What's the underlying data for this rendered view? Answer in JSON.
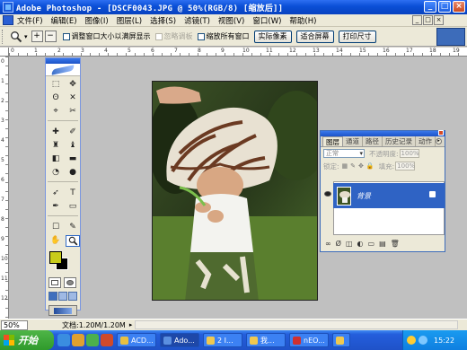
{
  "window": {
    "title": "Adobe Photoshop - [DSCF0043.JPG @ 50%(RGB/8) [缩放后]]",
    "controls": [
      "_",
      "□",
      "×"
    ]
  },
  "menu": {
    "items": [
      "文件(F)",
      "编辑(E)",
      "图像(I)",
      "图层(L)",
      "选择(S)",
      "滤镜(T)",
      "视图(V)",
      "窗口(W)",
      "帮助(H)"
    ],
    "mdi_controls": [
      "_",
      "□",
      "×"
    ]
  },
  "options": {
    "zoom_in": "+",
    "zoom_out": "−",
    "resize_windows": "调整窗口大小以满屏显示",
    "ignore_palettes": "忽略调板",
    "zoom_all_windows": "缩放所有窗口",
    "actual_pixels": "实际像素",
    "fit_on_screen": "适合屏幕",
    "print_size": "打印尺寸"
  },
  "rulers": {
    "top": [
      "0",
      "1",
      "2",
      "3",
      "4",
      "5",
      "6",
      "7",
      "8",
      "9",
      "10",
      "11",
      "12",
      "13",
      "14",
      "15",
      "16",
      "17",
      "18",
      "19"
    ],
    "left": [
      "0",
      "1",
      "2",
      "3",
      "4",
      "5",
      "6",
      "7",
      "8",
      "9",
      "10",
      "11",
      "12"
    ]
  },
  "toolbox": {
    "tools": [
      "⬚",
      "✥",
      "ʘ",
      "✕",
      "⌖",
      "✂",
      "✚",
      "✐",
      "♜",
      "♝",
      "◧",
      "▬",
      "◔",
      "●",
      "➶",
      "T",
      "✒",
      "▭",
      "☐",
      "✎",
      "✋",
      "🔍"
    ],
    "active_tool": "🔍",
    "fg_color": "#c8cc1a",
    "bg_color": "#000000"
  },
  "layers_panel": {
    "tabs": [
      "图层",
      "通道",
      "路径",
      "历史记录",
      "动作"
    ],
    "active_tab": "图层",
    "blend_mode": "正常",
    "opacity_label": "不透明度:",
    "opacity_value": "100%",
    "lock_label": "锁定:",
    "fill_label": "填充:",
    "fill_value": "100%",
    "layer_name": "背景",
    "bottom_icons": [
      "∞",
      "Ø",
      "◫",
      "◐",
      "▭",
      "▤",
      "🗑"
    ]
  },
  "status": {
    "zoom": "50%",
    "doc_size": "文档:1.20M/1.20M",
    "arrow": "▸"
  },
  "taskbar": {
    "start_label": "开始",
    "tasks": [
      {
        "label": "ACD...",
        "active": false
      },
      {
        "label": "Ado...",
        "active": true
      },
      {
        "label": "2 I...",
        "active": false
      },
      {
        "label": "我...",
        "active": false
      },
      {
        "label": "nEO...",
        "active": false
      },
      {
        "label": "",
        "active": false
      }
    ],
    "clock": "15:22"
  },
  "colors": {
    "title_blue": "#0a4fd6",
    "taskbar_blue": "#245edc",
    "start_green": "#3ea43a",
    "selected_layer": "#2f63c4"
  }
}
